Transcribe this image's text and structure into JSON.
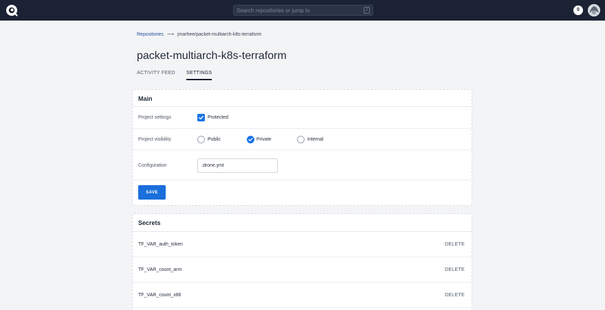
{
  "header": {
    "search_placeholder": "Search repositories or jump to",
    "search_shortcut": "/",
    "notification_count": "0",
    "colors": {
      "background": "#1a2233",
      "accent": "#1a73e8"
    }
  },
  "breadcrumb": {
    "root": "Repositories",
    "current": "jmarhee/packet-multiarch-k8s-terraform"
  },
  "page": {
    "title": "packet-multiarch-k8s-terraform"
  },
  "tabs": [
    {
      "label": "ACTIVITY FEED",
      "active": false
    },
    {
      "label": "SETTINGS",
      "active": true
    }
  ],
  "main_card": {
    "title": "Main",
    "project_settings": {
      "label": "Project settings",
      "checkbox_label": "Protected",
      "checked": true
    },
    "project_visibility": {
      "label": "Project visibility",
      "options": [
        {
          "label": "Public",
          "selected": false
        },
        {
          "label": "Private",
          "selected": true
        },
        {
          "label": "Internal",
          "selected": false
        }
      ]
    },
    "configuration": {
      "label": "Configuration",
      "value": ".drone.yml"
    },
    "save_label": "SAVE"
  },
  "secrets_card": {
    "title": "Secrets",
    "items": [
      {
        "name": "TF_VAR_auth_token",
        "action": "DELETE"
      },
      {
        "name": "TF_VAR_count_arm",
        "action": "DELETE"
      },
      {
        "name": "TF_VAR_count_x86",
        "action": "DELETE"
      }
    ]
  }
}
